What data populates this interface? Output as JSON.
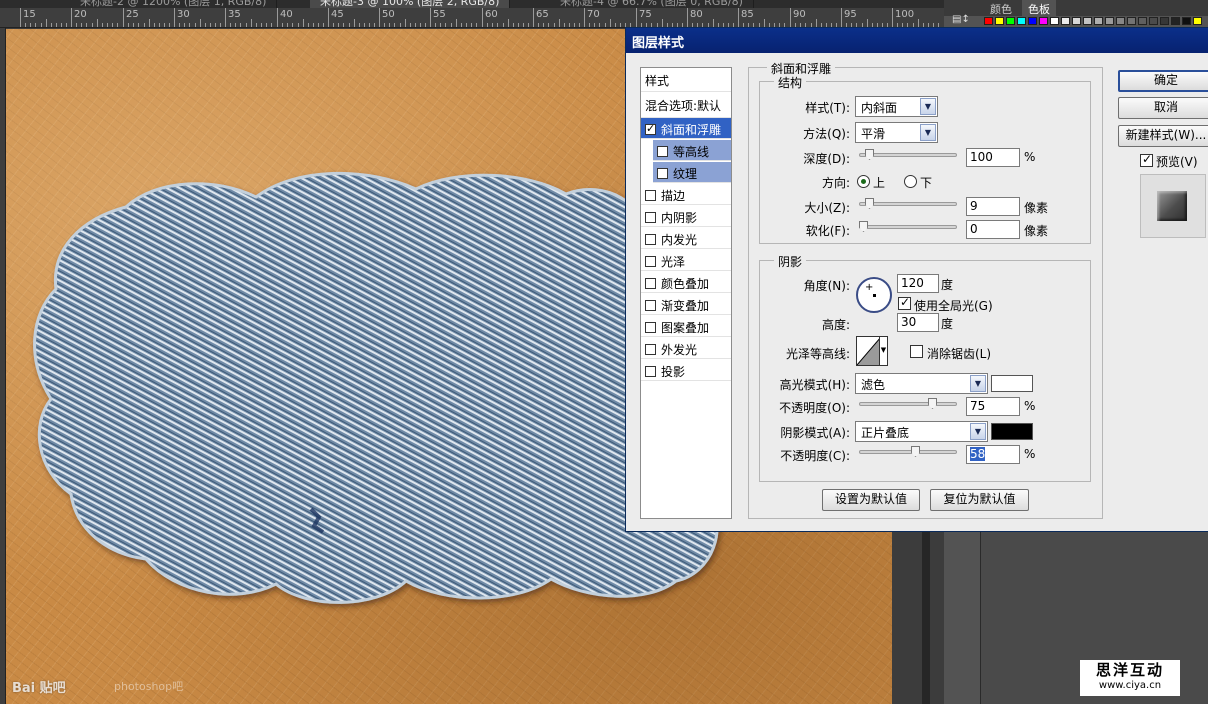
{
  "tabs": [
    {
      "label": "未标题-2 @ 1200% (图层 1, RGB/8)",
      "active": false
    },
    {
      "label": "未标题-3 @ 100% (图层 2, RGB/8)",
      "active": true
    },
    {
      "label": "未标题-4 @ 66.7% (图层 0, RGB/8)",
      "active": false
    }
  ],
  "ruler_labels": [
    "15",
    "20",
    "25",
    "30",
    "35",
    "40",
    "45",
    "50",
    "55",
    "60",
    "65",
    "70",
    "75",
    "80",
    "85",
    "90",
    "95",
    "100"
  ],
  "canvas": {
    "watermark": "Bai 贴吧",
    "watermark2": "photoshop吧"
  },
  "right_panel": {
    "tab_color": "颜色",
    "tab_swatches": "色板"
  },
  "logo": {
    "name": "思洋互动",
    "url": "www.ciya.cn"
  },
  "dialog": {
    "title": "图层样式",
    "style_list": {
      "header": "样式",
      "blend": "混合选项:默认",
      "items": [
        {
          "label": "斜面和浮雕",
          "checked": true
        },
        {
          "label": "等高线",
          "checked": false
        },
        {
          "label": "纹理",
          "checked": false
        },
        {
          "label": "描边",
          "checked": false
        },
        {
          "label": "内阴影",
          "checked": false
        },
        {
          "label": "内发光",
          "checked": false
        },
        {
          "label": "光泽",
          "checked": false
        },
        {
          "label": "颜色叠加",
          "checked": false
        },
        {
          "label": "渐变叠加",
          "checked": false
        },
        {
          "label": "图案叠加",
          "checked": false
        },
        {
          "label": "外发光",
          "checked": false
        },
        {
          "label": "投影",
          "checked": false
        }
      ]
    },
    "bevel": {
      "group_title": "斜面和浮雕",
      "structure_title": "结构",
      "style_label": "样式(T):",
      "style_value": "内斜面",
      "technique_label": "方法(Q):",
      "technique_value": "平滑",
      "depth_label": "深度(D):",
      "depth_value": "100",
      "depth_unit": "%",
      "direction_label": "方向:",
      "direction_up": "上",
      "direction_down": "下",
      "direction_selected": "上",
      "size_label": "大小(Z):",
      "size_value": "9",
      "size_unit": "像素",
      "soften_label": "软化(F):",
      "soften_value": "0",
      "soften_unit": "像素"
    },
    "shading": {
      "title": "阴影",
      "angle_label": "角度(N):",
      "angle_value": "120",
      "angle_unit": "度",
      "global_light_label": "使用全局光(G)",
      "global_light_checked": true,
      "altitude_label": "高度:",
      "altitude_value": "30",
      "altitude_unit": "度",
      "gloss_label": "光泽等高线:",
      "antialias_label": "消除锯齿(L)",
      "antialias_checked": false,
      "highlight_mode_label": "高光模式(H):",
      "highlight_mode_value": "滤色",
      "highlight_color": "#ffffff",
      "highlight_opacity_label": "不透明度(O):",
      "highlight_opacity_value": "75",
      "highlight_opacity_unit": "%",
      "shadow_mode_label": "阴影模式(A):",
      "shadow_mode_value": "正片叠底",
      "shadow_color": "#000000",
      "shadow_opacity_label": "不透明度(C):",
      "shadow_opacity_value": "58",
      "shadow_opacity_unit": "%"
    },
    "set_default": "设置为默认值",
    "reset_default": "复位为默认值",
    "ok": "确定",
    "cancel": "取消",
    "new_style": "新建样式(W)...",
    "preview_label": "预览(V)",
    "preview_checked": true
  }
}
